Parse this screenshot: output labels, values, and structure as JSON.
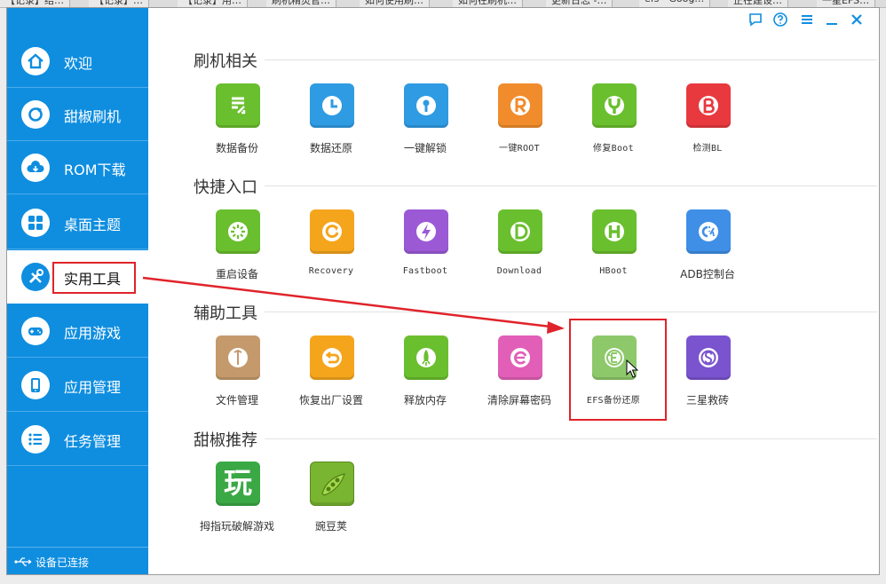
{
  "browser_tabs": [
    "【记录】结…",
    "【记录】…",
    "【记录】用…",
    "刷机精灵官…",
    "如何使用刷…",
    "如何在刷机…",
    "更新日志 -…",
    "efs - Goog…",
    "正在建设…",
    "一星EFS…"
  ],
  "sidebar": {
    "items": [
      {
        "label": "欢迎",
        "icon": "home-icon"
      },
      {
        "label": "甜椒刷机",
        "icon": "refresh-flash-icon"
      },
      {
        "label": "ROM下载",
        "icon": "cloud-download-icon"
      },
      {
        "label": "桌面主题",
        "icon": "grid-theme-icon"
      },
      {
        "label": "实用工具",
        "icon": "tools-icon",
        "active": true
      },
      {
        "label": "应用游戏",
        "icon": "gamepad-icon"
      },
      {
        "label": "应用管理",
        "icon": "phone-icon"
      },
      {
        "label": "任务管理",
        "icon": "list-icon"
      }
    ],
    "status": "设备已连接"
  },
  "sections": [
    {
      "title": "刷机相关",
      "tiles": [
        {
          "label": "数据备份",
          "color": "#6abf2e",
          "icon": "backup-icon"
        },
        {
          "label": "数据还原",
          "color": "#2f9be3",
          "icon": "clock-restore-icon"
        },
        {
          "label": "一键解锁",
          "color": "#2f9be3",
          "icon": "keyhole-icon"
        },
        {
          "label": "一键ROOT",
          "color": "#f08c2c",
          "icon": "root-r-icon"
        },
        {
          "label": "修复Boot",
          "color": "#6abf2e",
          "icon": "wrench-icon"
        },
        {
          "label": "检测BL",
          "color": "#e8393f",
          "icon": "bl-b-icon"
        }
      ]
    },
    {
      "title": "快捷入口",
      "tiles": [
        {
          "label": "重启设备",
          "color": "#6abf2e",
          "icon": "reboot-icon"
        },
        {
          "label": "Recovery",
          "color": "#f5a51c",
          "icon": "recovery-icon"
        },
        {
          "label": "Fastboot",
          "color": "#9b59d6",
          "icon": "lightning-icon"
        },
        {
          "label": "Download",
          "color": "#6abf2e",
          "icon": "download-d-icon"
        },
        {
          "label": "HBoot",
          "color": "#6abf2e",
          "icon": "hboot-h-icon"
        },
        {
          "label": "ADB控制台",
          "color": "#3f8fe6",
          "icon": "console-icon"
        }
      ]
    },
    {
      "title": "辅助工具",
      "tiles": [
        {
          "label": "文件管理",
          "color": "#c49a6c",
          "icon": "file-manager-icon"
        },
        {
          "label": "恢复出厂设置",
          "color": "#f5a51c",
          "icon": "factory-reset-icon"
        },
        {
          "label": "释放内存",
          "color": "#6abf2e",
          "icon": "rocket-icon"
        },
        {
          "label": "清除屏幕密码",
          "color": "#e25fb7",
          "icon": "clear-password-icon"
        },
        {
          "label": "EFS备份还原",
          "color": "#8dc86a",
          "icon": "efs-icon"
        },
        {
          "label": "三星救砖",
          "color": "#7a53cf",
          "icon": "samsung-rescue-icon"
        }
      ]
    },
    {
      "title": "甜椒推荐",
      "tiles": [
        {
          "label": "拇指玩破解游戏",
          "color": "#3aa845",
          "icon": "wan-game-icon",
          "glyph": "玩"
        },
        {
          "label": "豌豆荚",
          "color": "#79b530",
          "icon": "pea-pod-icon"
        }
      ]
    }
  ]
}
